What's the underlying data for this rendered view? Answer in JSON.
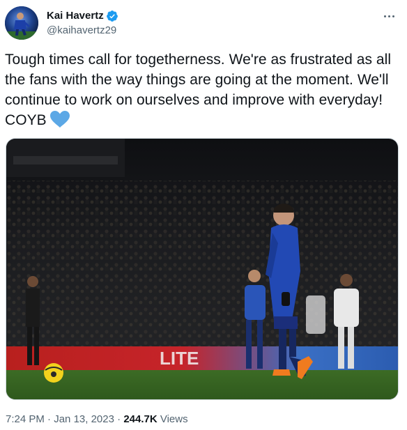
{
  "author": {
    "display_name": "Kai Havertz",
    "handle": "@kaihavertz29",
    "verified": true,
    "avatar_icon": "profile-photo-avatar"
  },
  "menu": {
    "icon": "more-options-icon"
  },
  "tweet": {
    "text": "Tough times call for togetherness. We're as frustrated as all the fans with the way things are going at the moment. We'll continue to work on ourselves and improve with everyday! COYB",
    "emoji": "blue-heart-icon",
    "emoji_color": "#5ca8e6"
  },
  "media": {
    "image_icon": "football-player-photo",
    "pitch_board_text": "LITE"
  },
  "meta": {
    "time": "7:24 PM",
    "separator1": "·",
    "date": "Jan 13, 2023",
    "separator2": "·",
    "views_count": "244.7K",
    "views_label": "Views"
  },
  "colors": {
    "text_primary": "#0f1419",
    "text_secondary": "#536471",
    "verified_blue": "#1d9bf0",
    "border": "#cfd9de"
  }
}
